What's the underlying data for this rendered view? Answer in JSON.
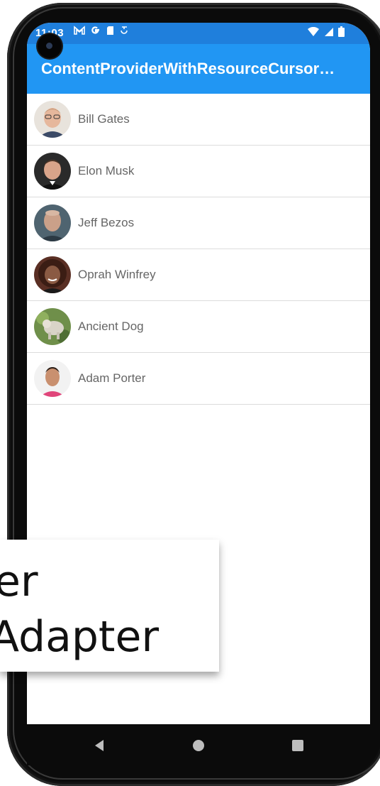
{
  "status_bar": {
    "time": "11:03",
    "left_icons": [
      "gmail-icon",
      "google-icon",
      "sim-icon",
      "data-saver-icon"
    ],
    "right_icons": [
      "wifi-icon",
      "signal-icon",
      "battery-icon"
    ]
  },
  "app_bar": {
    "title": "ContentProviderWithResourceCursor…"
  },
  "contacts": [
    {
      "name": "Bill Gates"
    },
    {
      "name": "Elon Musk"
    },
    {
      "name": "Jeff Bezos"
    },
    {
      "name": "Oprah Winfrey"
    },
    {
      "name": "Ancient Dog"
    },
    {
      "name": "Adam Porter"
    }
  ],
  "overlay": {
    "line1": "er",
    "line2": "Adapter"
  },
  "colors": {
    "status_bar": "#1f7fdc",
    "app_bar": "#2196f3",
    "text_secondary": "#666666"
  }
}
